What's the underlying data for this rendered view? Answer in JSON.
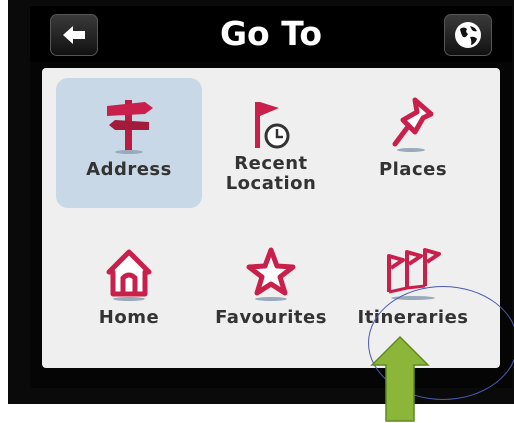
{
  "header": {
    "title": "Go To",
    "back_icon": "back-arrow-icon",
    "globe_icon": "globe-icon"
  },
  "menu": {
    "items": [
      {
        "label": "Address",
        "icon": "signpost-icon",
        "selected": true
      },
      {
        "label": "Recent\nLocation",
        "icon": "flag-clock-icon",
        "selected": false
      },
      {
        "label": "Places",
        "icon": "pushpin-icon",
        "selected": false
      },
      {
        "label": "Home",
        "icon": "house-icon",
        "selected": false
      },
      {
        "label": "Favourites",
        "icon": "star-icon",
        "selected": false
      },
      {
        "label": "Itineraries",
        "icon": "flags-icon",
        "selected": false
      }
    ]
  },
  "colors": {
    "icon": "#c8204a",
    "selected_tile": "#c8d8e6",
    "annotation_arrow": "#8bb63a",
    "annotation_oval": "#4a5ab0"
  }
}
